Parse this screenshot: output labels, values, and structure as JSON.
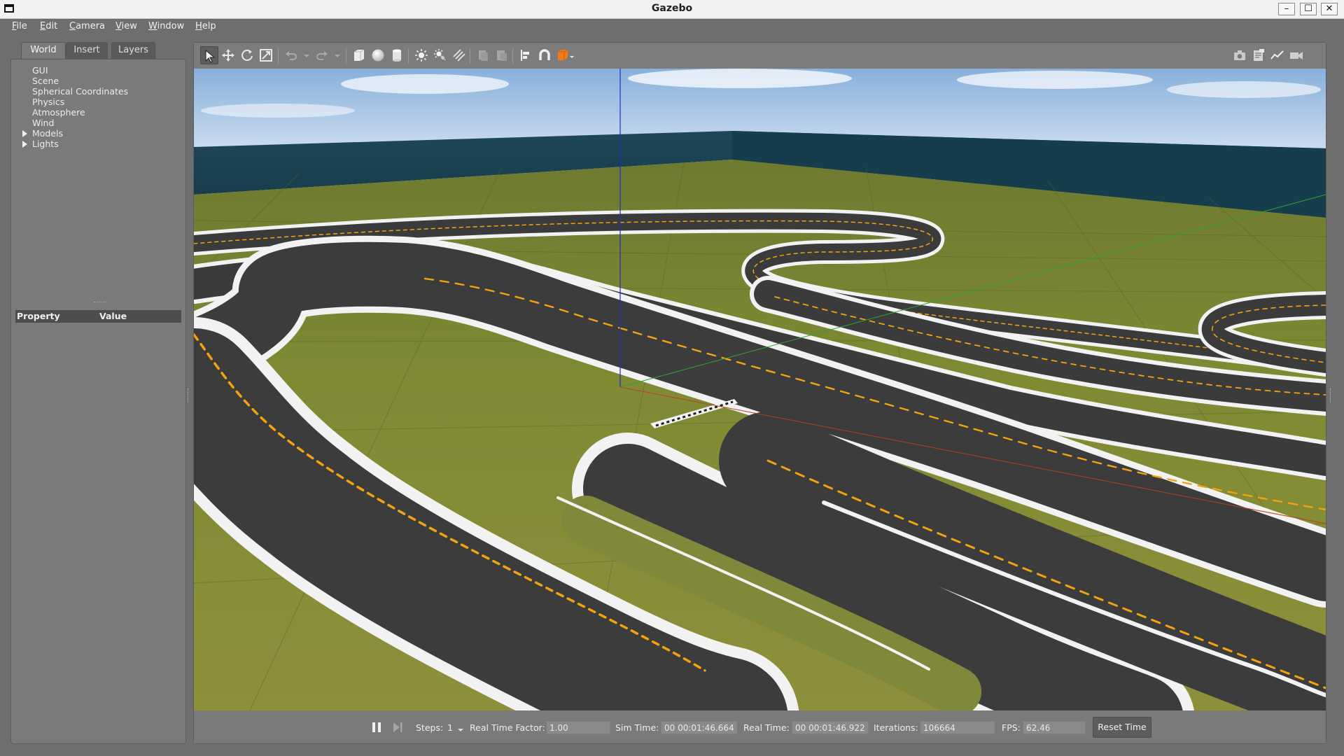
{
  "window": {
    "title": "Gazebo",
    "minimize_glyph": "–",
    "maximize_glyph": "☐",
    "close_glyph": "✕"
  },
  "menu": {
    "items": [
      {
        "label": "File",
        "u": "F",
        "rest": "ile"
      },
      {
        "label": "Edit",
        "u": "E",
        "rest": "dit"
      },
      {
        "label": "Camera",
        "u": "C",
        "rest": "amera"
      },
      {
        "label": "View",
        "u": "V",
        "rest": "iew"
      },
      {
        "label": "Window",
        "u": "W",
        "rest": "indow"
      },
      {
        "label": "Help",
        "u": "H",
        "rest": "elp"
      }
    ]
  },
  "left_panel": {
    "tabs": [
      "World",
      "Insert",
      "Layers"
    ],
    "active_tab": "World",
    "tree": [
      "GUI",
      "Scene",
      "Spherical Coordinates",
      "Physics",
      "Atmosphere",
      "Wind",
      "Models",
      "Lights"
    ],
    "expandable": [
      "Models",
      "Lights"
    ],
    "property_header": {
      "property": "Property",
      "value": "Value"
    }
  },
  "toolbar": {
    "tools": [
      {
        "name": "select-mode",
        "icon": "arrow-pointer-icon",
        "active": true
      },
      {
        "name": "translate-mode",
        "icon": "move-icon"
      },
      {
        "name": "rotate-mode",
        "icon": "rotate-icon"
      },
      {
        "name": "scale-mode",
        "icon": "scale-icon"
      },
      {
        "name": "undo",
        "icon": "undo-icon"
      },
      {
        "name": "redo",
        "icon": "redo-icon"
      },
      {
        "name": "box-shape",
        "icon": "box-icon"
      },
      {
        "name": "sphere-shape",
        "icon": "sphere-icon"
      },
      {
        "name": "cylinder-shape",
        "icon": "cylinder-icon"
      },
      {
        "name": "point-light",
        "icon": "point-light-icon"
      },
      {
        "name": "spot-light",
        "icon": "spot-light-icon"
      },
      {
        "name": "directional-light",
        "icon": "directional-light-icon"
      },
      {
        "name": "copy",
        "icon": "copy-icon"
      },
      {
        "name": "paste",
        "icon": "paste-icon"
      },
      {
        "name": "align",
        "icon": "align-icon"
      },
      {
        "name": "snap",
        "icon": "magnet-icon"
      },
      {
        "name": "change-view",
        "icon": "view-cube-icon"
      },
      {
        "name": "screenshot",
        "icon": "camera-icon"
      },
      {
        "name": "log",
        "icon": "log-icon"
      },
      {
        "name": "plot",
        "icon": "plot-icon"
      },
      {
        "name": "record-video",
        "icon": "video-icon"
      }
    ],
    "colors": {
      "accent": "#f07a1a"
    }
  },
  "viewport": {
    "scene": "race-track-world",
    "colors": {
      "grass": "#7f8a33",
      "asphalt": "#3b3b3b",
      "lane_line": "#f2a30f",
      "border": "#f2f2f2",
      "wall": "#1c4452",
      "sky": "#a8c6e4"
    }
  },
  "bottom_bar": {
    "steps_label": "Steps:",
    "steps_value": "1",
    "rtf_label": "Real Time Factor:",
    "rtf_value": "1.00",
    "sim_time_label": "Sim Time:",
    "sim_time_value": "00 00:01:46.664",
    "real_time_label": "Real Time:",
    "real_time_value": "00 00:01:46.922",
    "iterations_label": "Iterations:",
    "iterations_value": "106664",
    "fps_label": "FPS:",
    "fps_value": "62.46",
    "reset_label": "Reset Time"
  }
}
